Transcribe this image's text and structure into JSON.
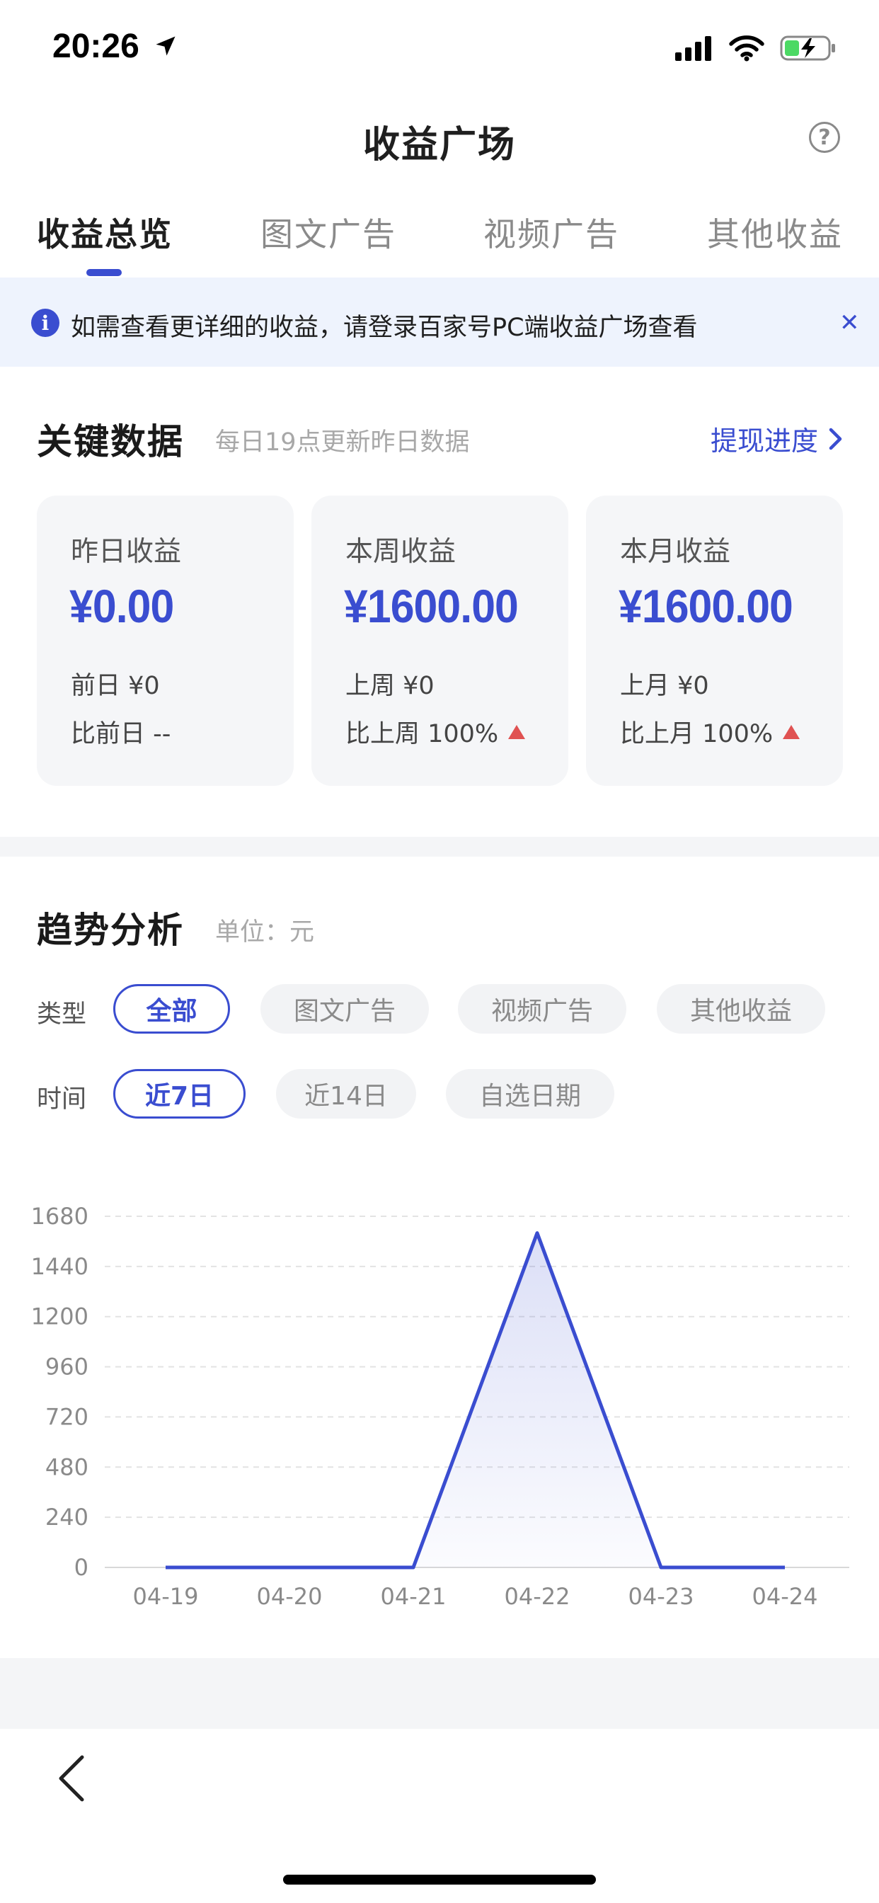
{
  "status_bar": {
    "time": "20:26",
    "battery": "charging"
  },
  "header": {
    "title": "收益广场"
  },
  "tabs": [
    {
      "label": "收益总览",
      "active": true
    },
    {
      "label": "图文广告",
      "active": false
    },
    {
      "label": "视频广告",
      "active": false
    },
    {
      "label": "其他收益",
      "active": false
    }
  ],
  "notice": {
    "text": "如需查看更详细的收益，请登录百家号PC端收益广场查看",
    "close_icon": "close-icon"
  },
  "key_data": {
    "title": "关键数据",
    "subtitle": "每日19点更新昨日数据",
    "withdraw_link": "提现进度",
    "cards": [
      {
        "label": "昨日收益",
        "value": "¥0.00",
        "prev": "前日 ¥0",
        "compare": "比前日 --",
        "trend": "none"
      },
      {
        "label": "本周收益",
        "value": "¥1600.00",
        "prev": "上周 ¥0",
        "compare": "比上周 100%",
        "trend": "up"
      },
      {
        "label": "本月收益",
        "value": "¥1600.00",
        "prev": "上月 ¥0",
        "compare": "比上月 100%",
        "trend": "up"
      }
    ]
  },
  "trend": {
    "title": "趋势分析",
    "unit": "单位：元",
    "type_label": "类型",
    "type_options": [
      {
        "label": "全部",
        "active": true
      },
      {
        "label": "图文广告",
        "active": false
      },
      {
        "label": "视频广告",
        "active": false
      },
      {
        "label": "其他收益",
        "active": false
      }
    ],
    "time_label": "时间",
    "time_options": [
      {
        "label": "近7日",
        "active": true
      },
      {
        "label": "近14日",
        "active": false
      },
      {
        "label": "自选日期",
        "active": false
      }
    ]
  },
  "chart_data": {
    "type": "area",
    "x": [
      "04-19",
      "04-20",
      "04-21",
      "04-22",
      "04-23",
      "04-24"
    ],
    "series": [
      {
        "values": [
          0,
          0,
          0,
          1600,
          0,
          0
        ]
      }
    ],
    "yticks": [
      0,
      240,
      480,
      720,
      960,
      1200,
      1440,
      1680
    ],
    "ylim": [
      0,
      1680
    ],
    "grid": true,
    "color": "#3a4dd0"
  },
  "colors": {
    "accent": "#3a4dd0",
    "up": "#e05252",
    "notice_bg": "#eef3fd"
  }
}
